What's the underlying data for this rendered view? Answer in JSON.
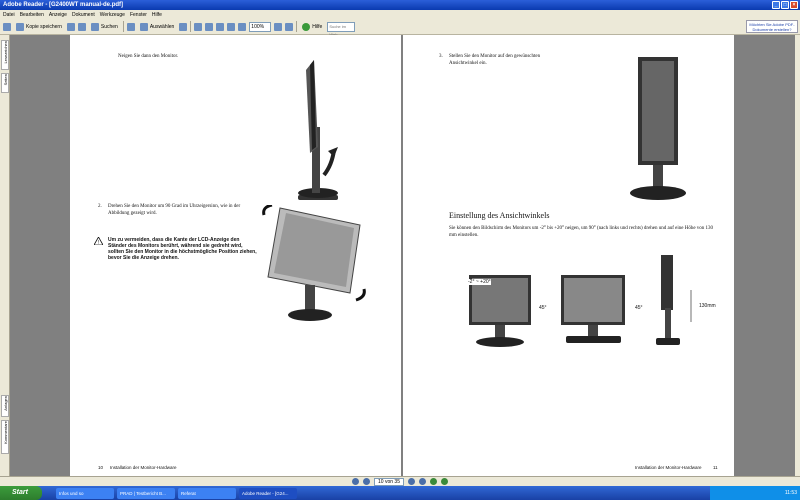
{
  "window": {
    "title": "Adobe Reader - [G2400WT manual-de.pdf]"
  },
  "menu": [
    "Datei",
    "Bearbeiten",
    "Anzeige",
    "Dokument",
    "Werkzeuge",
    "Fenster",
    "Hilfe"
  ],
  "toolbar": {
    "save_copy": "Kopie speichern",
    "search": "Suchen",
    "select": "Auswählen",
    "zoom": "100%",
    "help": "Hilfe",
    "search_web_placeholder": "Suche im Web",
    "promo": "Möchten Sie Adobe PDF-Dokumente erstellen?"
  },
  "sidepanel": {
    "tabs": [
      "Lesezeichen",
      "Seiten",
      "Anlagen",
      "Kommentare"
    ]
  },
  "page_left": {
    "step1": "Neigen Sie dann den Monitor.",
    "step2_num": "2.",
    "step2": "Drehen Sie den Monitor um 90 Grad im Uhrzeigersinn, wie in der Abbildung gezeigt wird.",
    "warning": "Um zu vermeiden, dass die Kante der LCD-Anzeige den Ständer des Monitors berührt, während sie gedreht wird, sollten Sie den Monitor in die höchstmögliche Position ziehen, bevor Sie die Anzeige drehen.",
    "footer_num": "10",
    "footer_text": "Installation der Monitor-Hardware"
  },
  "page_right": {
    "step3_num": "3.",
    "step3": "Stellen Sie den Monitor auf den gewünschten Ansichtwinkel ein.",
    "heading": "Einstellung des Ansichtwinkels",
    "body": "Sie können den Bildschirm des Monitors um -2° bis +20° neigen, um 90° (nach links und rechts) drehen und auf eine Höhe von 130 mm einstellen.",
    "tilt_label": "-2° ~ +20°",
    "swivel_left": "45°",
    "swivel_right": "45°",
    "height_label": "130mm",
    "footer_text": "Installation der Monitor-Hardware",
    "footer_num": "11"
  },
  "nav": {
    "page": "10 von 35"
  },
  "taskbar": {
    "start": "Start",
    "tasks": [
      "Infos und so",
      "PRAD | Testbericht B...",
      "Referat",
      "Adobe Reader - [G24..."
    ],
    "clock": "11:53"
  }
}
